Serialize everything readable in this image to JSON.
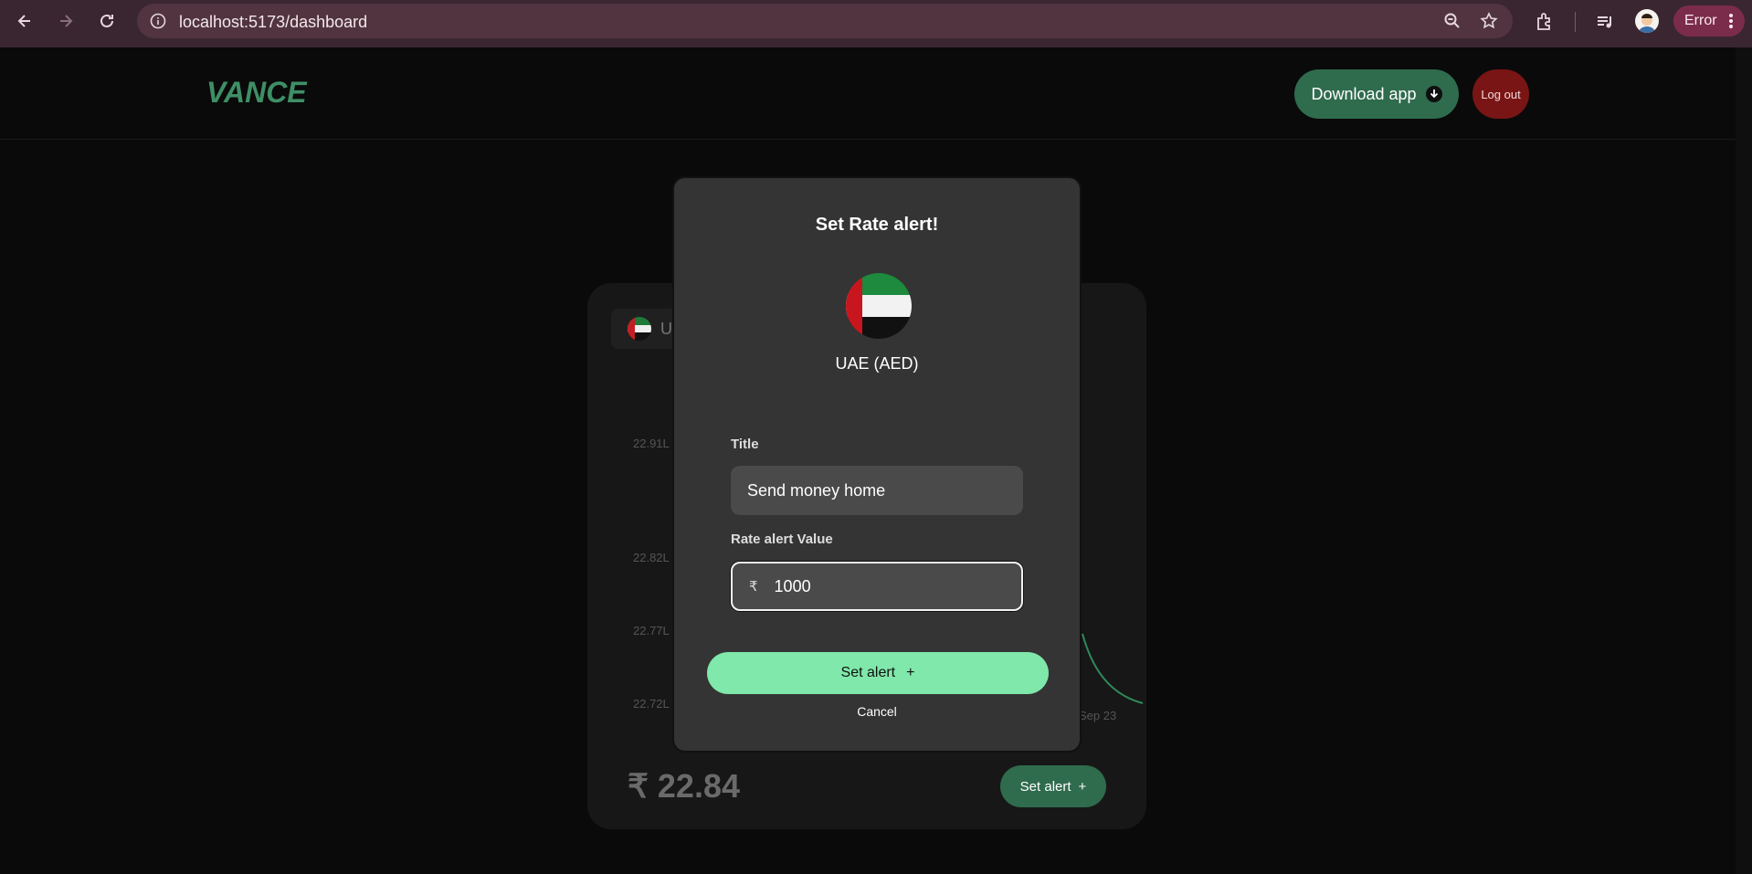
{
  "browser": {
    "url": "localhost:5173/dashboard",
    "error_label": "Error"
  },
  "header": {
    "logo_text": "VANCE",
    "download_label": "Download app",
    "logout_label": "Log out"
  },
  "card": {
    "currency_chip_label": "U",
    "y_ticks": [
      "22.91L",
      "22.82L",
      "22.77L",
      "22.72L"
    ],
    "x_tick": "Sep 23",
    "price": "₹ 22.84",
    "set_alert_label": "Set alert",
    "set_alert_icon": "+"
  },
  "modal": {
    "title": "Set Rate alert!",
    "flag_icon": "uae-flag-icon",
    "currency_label": "UAE (AED)",
    "title_field_label": "Title",
    "title_field_value": "Send money home",
    "rate_field_label": "Rate alert Value",
    "rate_currency_symbol": "₹",
    "rate_field_value": "1000",
    "set_alert_label": "Set alert",
    "set_alert_icon": "+",
    "cancel_label": "Cancel"
  },
  "colors": {
    "accent": "#7fe8aa",
    "brand_green": "#2f6b4d",
    "logout_red": "#7a1515",
    "modal_bg": "#343434"
  }
}
